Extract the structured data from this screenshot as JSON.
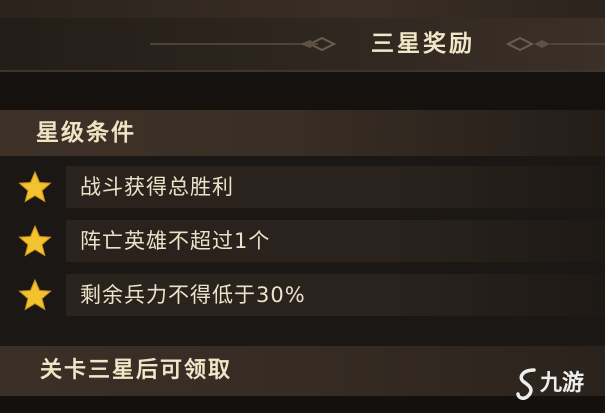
{
  "header": {
    "title": "三星奖励"
  },
  "conditions": {
    "section_title": "星级条件",
    "items": [
      {
        "label": "战斗获得总胜利",
        "icon": "star-icon"
      },
      {
        "label": "阵亡英雄不超过1个",
        "icon": "star-icon"
      },
      {
        "label": "剩余兵力不得低于30%",
        "icon": "star-icon"
      }
    ]
  },
  "footer": {
    "claim_text": "关卡三星后可领取"
  },
  "watermark": {
    "text": "九游"
  },
  "colors": {
    "star": "#f3c22f",
    "text": "#ece2c8",
    "bar": "#3a2f26",
    "background": "#1b1714"
  }
}
